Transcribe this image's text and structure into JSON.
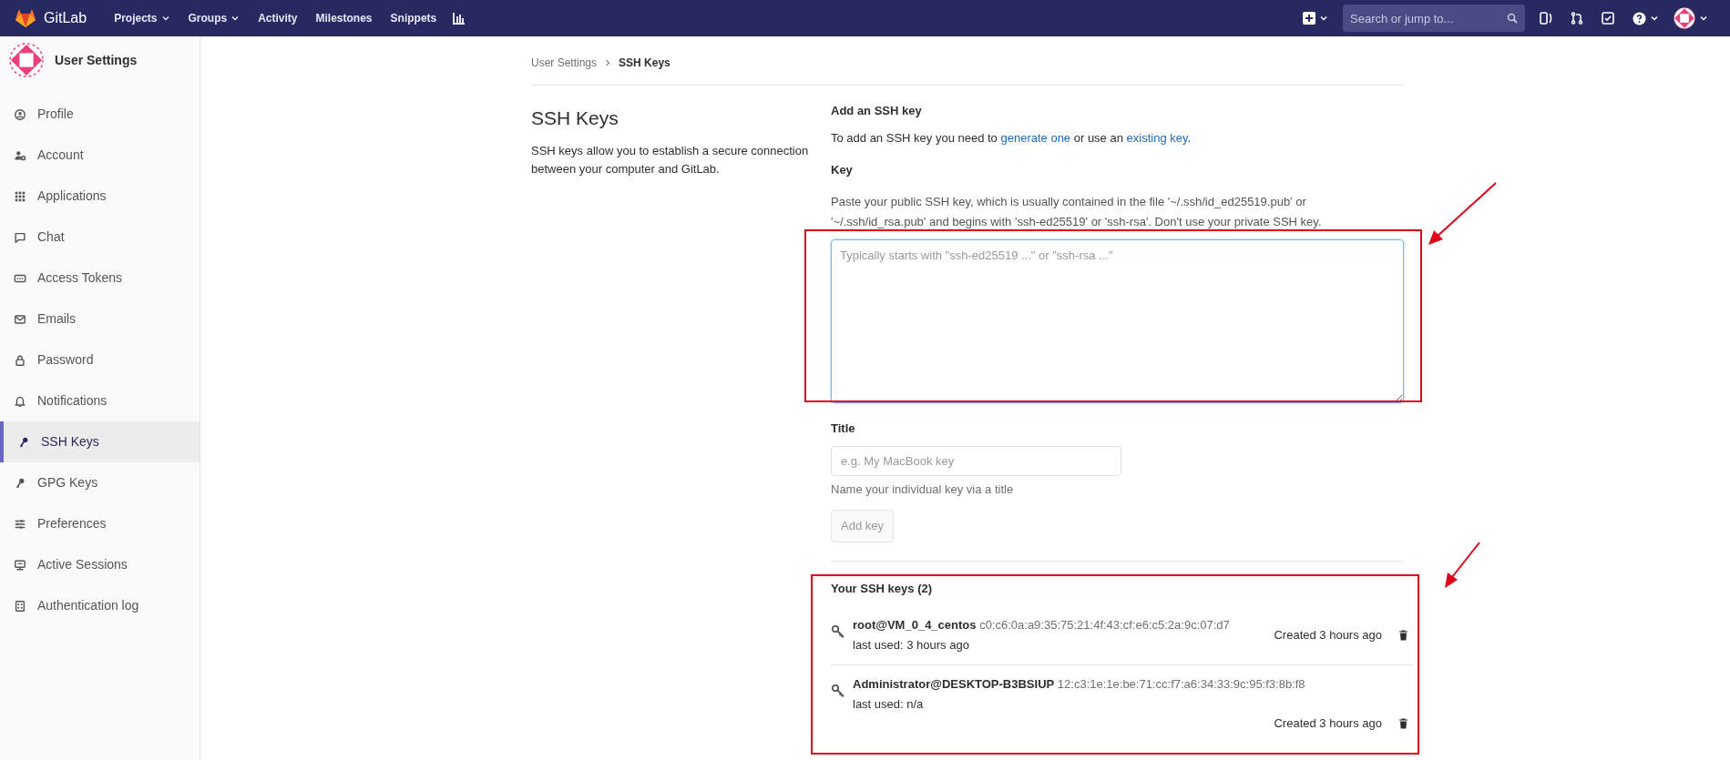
{
  "navbar": {
    "brand": "GitLab",
    "links": [
      {
        "label": "Projects",
        "dropdown": true
      },
      {
        "label": "Groups",
        "dropdown": true
      },
      {
        "label": "Activity",
        "dropdown": false
      },
      {
        "label": "Milestones",
        "dropdown": false
      },
      {
        "label": "Snippets",
        "dropdown": false
      }
    ],
    "search": {
      "placeholder": "Search or jump to..."
    }
  },
  "sidebar": {
    "title": "User Settings",
    "items": [
      {
        "label": "Profile",
        "selected": false
      },
      {
        "label": "Account",
        "selected": false
      },
      {
        "label": "Applications",
        "selected": false
      },
      {
        "label": "Chat",
        "selected": false
      },
      {
        "label": "Access Tokens",
        "selected": false
      },
      {
        "label": "Emails",
        "selected": false
      },
      {
        "label": "Password",
        "selected": false
      },
      {
        "label": "Notifications",
        "selected": false
      },
      {
        "label": "SSH Keys",
        "selected": true
      },
      {
        "label": "GPG Keys",
        "selected": false
      },
      {
        "label": "Preferences",
        "selected": false
      },
      {
        "label": "Active Sessions",
        "selected": false
      },
      {
        "label": "Authentication log",
        "selected": false
      }
    ]
  },
  "breadcrumb": [
    "User Settings",
    "SSH Keys"
  ],
  "intro": {
    "title": "SSH Keys",
    "description": "SSH keys allow you to establish a secure connection between your computer and GitLab."
  },
  "form": {
    "heading": "Add an SSH key",
    "help": [
      {
        "kind": "text",
        "text": "To add an SSH key you need to "
      },
      {
        "kind": "link",
        "text": "generate one"
      },
      {
        "kind": "text",
        "text": " or use an "
      },
      {
        "kind": "link",
        "text": "existing key"
      },
      {
        "kind": "text",
        "text": "."
      }
    ],
    "key_label": "Key",
    "key_help": "Paste your public SSH key, which is usually contained in the file '~/.ssh/id_ed25519.pub' or '~/.ssh/id_rsa.pub' and begins with 'ssh-ed25519' or 'ssh-rsa'. Don't use your private SSH key.",
    "key_placeholder": "Typically starts with \"ssh-ed25519 ...\" or \"ssh-rsa ...\"",
    "title_label": "Title",
    "title_placeholder": "e.g. My MacBook key",
    "title_help": "Name your individual key via a title",
    "submit": "Add key",
    "submit_disabled": true
  },
  "keys": {
    "heading": "Your SSH keys (2)",
    "items": [
      {
        "title": "root@VM_0_4_centos",
        "fingerprint": "c0:c6:0a:a9:35:75:21:4f:43:cf:e6:c5:2a:9c:07:d7",
        "last_used": "last used: 3 hours ago",
        "created": "Created 3 hours ago"
      },
      {
        "title": "Administrator@DESKTOP-B3BSIUP",
        "fingerprint": "12:c3:1e:1e:be:71:cc:f7:a6:34:33:9c:95:f3:8b:f8",
        "last_used": "last used: n/a",
        "created": "Created 3 hours ago"
      }
    ]
  }
}
